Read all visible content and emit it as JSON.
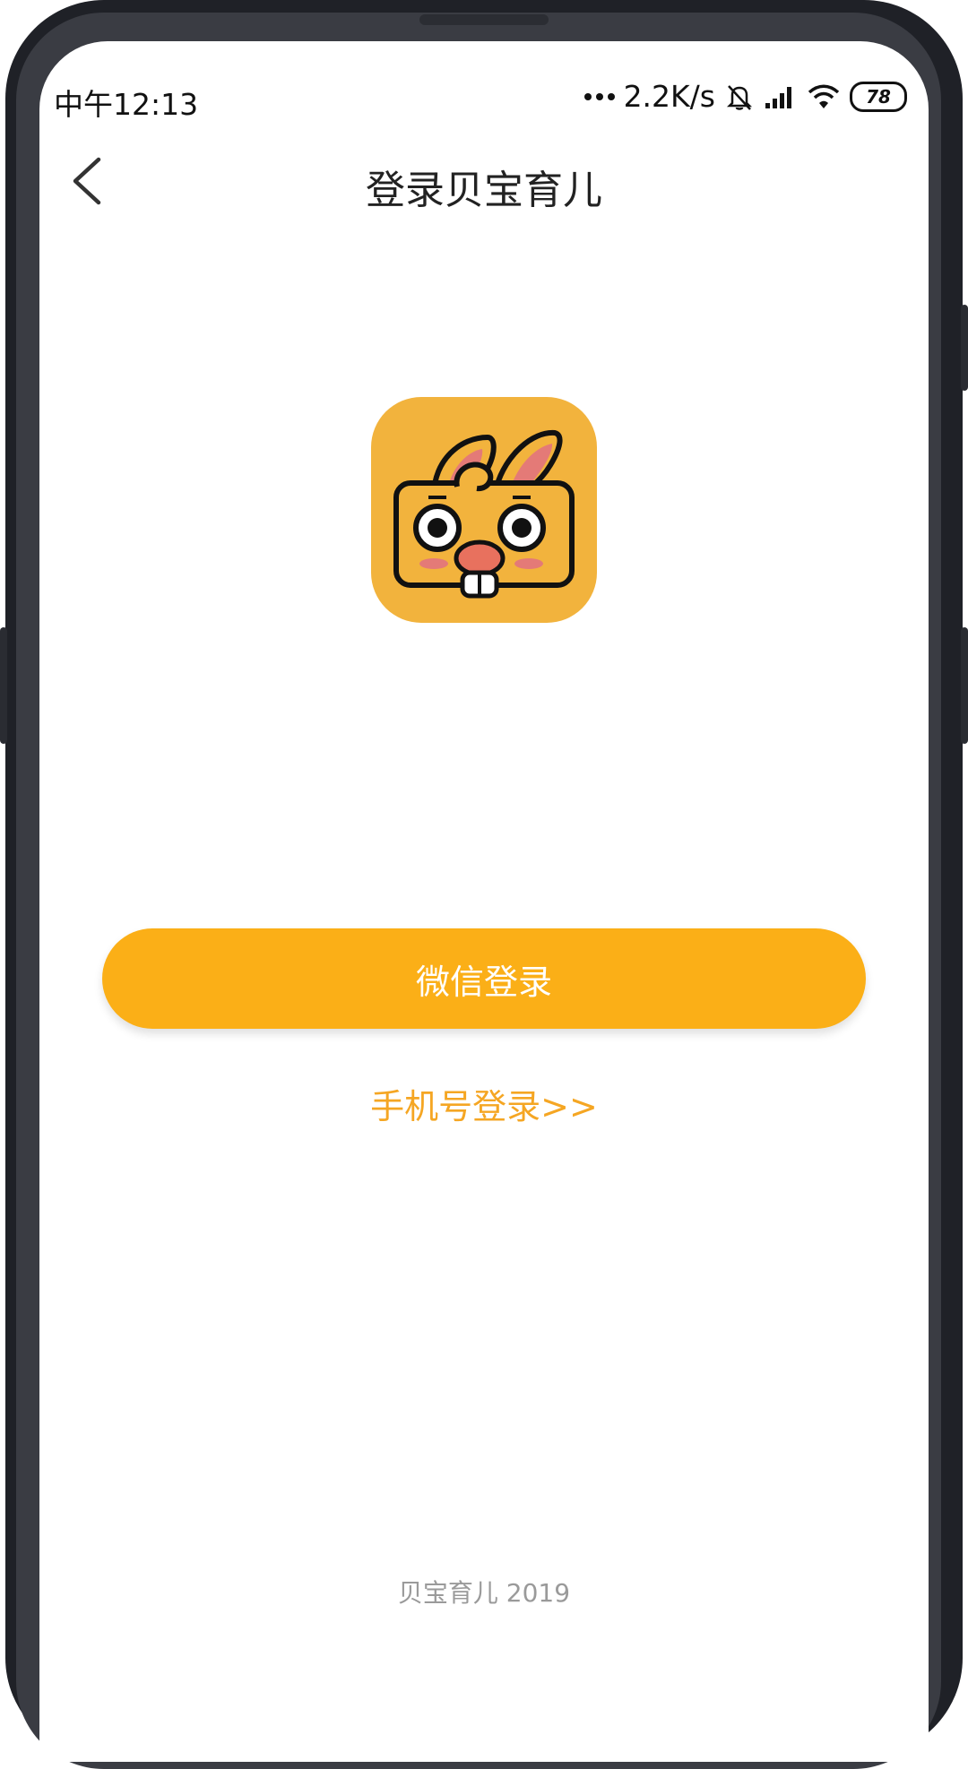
{
  "status_bar": {
    "time": "中午12:13",
    "network_speed": "2.2K/s",
    "battery": "78",
    "icons": [
      "mute-icon",
      "signal-icon",
      "wifi-icon",
      "battery-icon"
    ]
  },
  "header": {
    "title": "登录贝宝育儿",
    "back_icon": "chevron-left-icon"
  },
  "logo": {
    "icon": "rabbit-logo-icon"
  },
  "actions": {
    "wechat_login": "微信登录",
    "phone_login": "手机号登录>>"
  },
  "footer": {
    "text": "贝宝育儿 2019"
  },
  "colors": {
    "primary": "#fbaf17",
    "link": "#f5a623",
    "logo_bg": "#f2b33d",
    "frame": "#1f2127"
  }
}
